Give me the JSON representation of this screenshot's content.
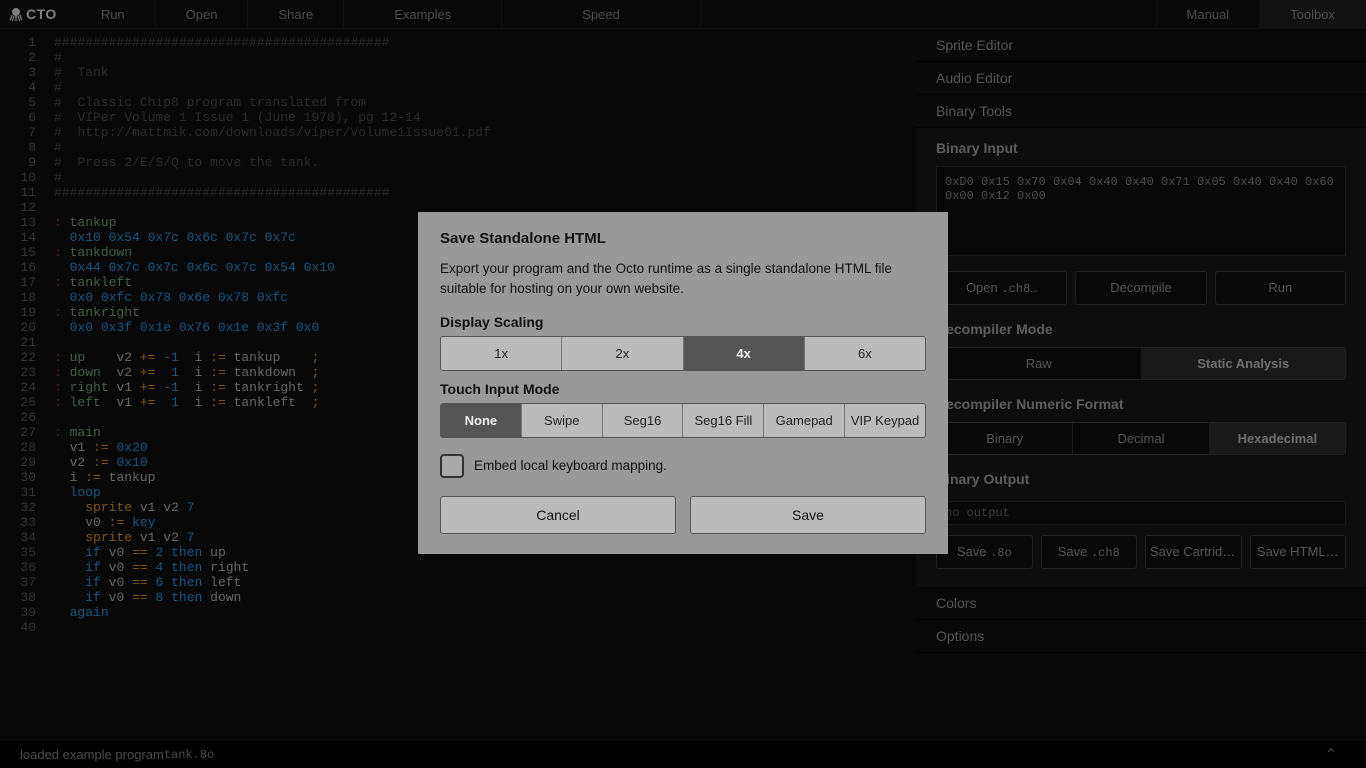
{
  "logo_text": "CTO",
  "topbar": {
    "run": "Run",
    "open": "Open",
    "share": "Share",
    "examples": "Examples",
    "speed": "Speed",
    "manual": "Manual",
    "toolbox": "Toolbox"
  },
  "code_lines": [
    {
      "n": 1,
      "html": "<span class='c-comment'>###########################################</span>"
    },
    {
      "n": 2,
      "html": "<span class='c-comment'>#</span>"
    },
    {
      "n": 3,
      "html": "<span class='c-comment'>#  Tank</span>"
    },
    {
      "n": 4,
      "html": "<span class='c-comment'>#</span>"
    },
    {
      "n": 5,
      "html": "<span class='c-comment'>#  Classic Chip8 program translated from</span>"
    },
    {
      "n": 6,
      "html": "<span class='c-comment'>#  VIPer Volume 1 Issue 1 (June 1978), pg 12-14</span>"
    },
    {
      "n": 7,
      "html": "<span class='c-comment'>#  http://mattmik.com/downloads/viper/Volume1Issue01.pdf</span>"
    },
    {
      "n": 8,
      "html": "<span class='c-comment'>#</span>"
    },
    {
      "n": 9,
      "html": "<span class='c-comment'>#  Press 2/E/S/Q to move the tank.</span>"
    },
    {
      "n": 10,
      "html": "<span class='c-comment'>#</span>"
    },
    {
      "n": 11,
      "html": "<span class='c-comment'>###########################################</span>"
    },
    {
      "n": 12,
      "html": ""
    },
    {
      "n": 13,
      "html": "<span class='c-label'>:</span> <span class='c-def'>tankup</span>"
    },
    {
      "n": 14,
      "html": "  <span class='c-num'>0x10 0x54 0x7c 0x6c 0x7c 0x7c</span>"
    },
    {
      "n": 15,
      "html": "<span class='c-label'>:</span> <span class='c-def'>tankdown</span>"
    },
    {
      "n": 16,
      "html": "  <span class='c-num'>0x44 0x7c 0x7c 0x6c 0x7c 0x54 0x10</span>"
    },
    {
      "n": 17,
      "html": "<span class='c-label'>:</span> <span class='c-def'>tankleft</span>"
    },
    {
      "n": 18,
      "html": "  <span class='c-num'>0x0 0xfc 0x78 0x6e 0x78 0xfc</span>"
    },
    {
      "n": 19,
      "html": "<span class='c-label'>:</span> <span class='c-def'>tankright</span>"
    },
    {
      "n": 20,
      "html": "  <span class='c-num'>0x0 0x3f 0x1e 0x76 0x1e 0x3f 0x0</span>"
    },
    {
      "n": 21,
      "html": ""
    },
    {
      "n": 22,
      "html": "<span class='c-label'>:</span> <span class='c-def'>up</span>    <span class='c-id'>v2</span> <span class='c-op'>+=</span> <span class='c-num'>-1</span>  <span class='c-id'>i</span> <span class='c-op'>:=</span> <span class='c-id'>tankup</span>    <span class='c-at'>;</span>"
    },
    {
      "n": 23,
      "html": "<span class='c-label'>:</span> <span class='c-def'>down</span>  <span class='c-id'>v2</span> <span class='c-op'>+=</span>  <span class='c-num'>1</span>  <span class='c-id'>i</span> <span class='c-op'>:=</span> <span class='c-id'>tankdown</span>  <span class='c-at'>;</span>"
    },
    {
      "n": 24,
      "html": "<span class='c-label'>:</span> <span class='c-def'>right</span> <span class='c-id'>v1</span> <span class='c-op'>+=</span> <span class='c-num'>-1</span>  <span class='c-id'>i</span> <span class='c-op'>:=</span> <span class='c-id'>tankright</span> <span class='c-at'>;</span>"
    },
    {
      "n": 25,
      "html": "<span class='c-label'>:</span> <span class='c-def'>left</span>  <span class='c-id'>v1</span> <span class='c-op'>+=</span>  <span class='c-num'>1</span>  <span class='c-id'>i</span> <span class='c-op'>:=</span> <span class='c-id'>tankleft</span>  <span class='c-at'>;</span>"
    },
    {
      "n": 26,
      "html": ""
    },
    {
      "n": 27,
      "html": "<span class='c-label'>:</span> <span class='c-def'>main</span>"
    },
    {
      "n": 28,
      "html": "  <span class='c-id'>v1</span> <span class='c-op'>:=</span> <span class='c-num'>0x20</span>"
    },
    {
      "n": 29,
      "html": "  <span class='c-id'>v2</span> <span class='c-op'>:=</span> <span class='c-num'>0x10</span>"
    },
    {
      "n": 30,
      "html": "  <span class='c-id'>i</span> <span class='c-op'>:=</span> <span class='c-id'>tankup</span>"
    },
    {
      "n": 31,
      "html": "  <span class='c-kw'>loop</span>"
    },
    {
      "n": 32,
      "html": "    <span class='c-op'>sprite</span> <span class='c-id'>v1</span> <span class='c-id'>v2</span> <span class='c-num'>7</span>"
    },
    {
      "n": 33,
      "html": "    <span class='c-id'>v0</span> <span class='c-op'>:=</span> <span class='c-kw'>key</span>"
    },
    {
      "n": 34,
      "html": "    <span class='c-op'>sprite</span> <span class='c-id'>v1</span> <span class='c-id'>v2</span> <span class='c-num'>7</span>"
    },
    {
      "n": 35,
      "html": "    <span class='c-kw'>if</span> <span class='c-id'>v0</span> <span class='c-op'>==</span> <span class='c-num'>2</span> <span class='c-kw'>then</span> <span class='c-id'>up</span>"
    },
    {
      "n": 36,
      "html": "    <span class='c-kw'>if</span> <span class='c-id'>v0</span> <span class='c-op'>==</span> <span class='c-num'>4</span> <span class='c-kw'>then</span> <span class='c-id'>right</span>"
    },
    {
      "n": 37,
      "html": "    <span class='c-kw'>if</span> <span class='c-id'>v0</span> <span class='c-op'>==</span> <span class='c-num'>6</span> <span class='c-kw'>then</span> <span class='c-id'>left</span>"
    },
    {
      "n": 38,
      "html": "    <span class='c-kw'>if</span> <span class='c-id'>v0</span> <span class='c-op'>==</span> <span class='c-num'>8</span> <span class='c-kw'>then</span> <span class='c-id'>down</span>"
    },
    {
      "n": 39,
      "html": "  <span class='c-kw'>again</span>"
    },
    {
      "n": 40,
      "html": ""
    }
  ],
  "sidebar": {
    "sections": {
      "sprite": "Sprite Editor",
      "audio": "Audio Editor",
      "binary": "Binary Tools",
      "colors": "Colors",
      "options": "Options"
    },
    "binary": {
      "input_heading": "Binary Input",
      "input_value": "0xD0 0x15 0x70 0x04 0x40 0x40 0x71 0x05 0x40 0x40 0x60 0x00 0x12 0x00",
      "open_label": "Open ",
      "open_ext": ".ch8…",
      "decompile": "Decompile",
      "run": "Run",
      "mode_heading": "Decompiler Mode",
      "mode_options": [
        "Raw",
        "Static Analysis"
      ],
      "mode_selected": 1,
      "fmt_heading": "Decompiler Numeric Format",
      "fmt_options": [
        "Binary",
        "Decimal",
        "Hexadecimal"
      ],
      "fmt_selected": 2,
      "output_heading": "Binary Output",
      "output_placeholder": "no output",
      "save8o": "Save ",
      "save8o_ext": ".8o",
      "savech8": "Save ",
      "savech8_ext": ".ch8",
      "savecart": "Save Cartridge…",
      "savehtml": "Save HTML…"
    }
  },
  "status": {
    "text": "loaded example program ",
    "file": "tank.8o",
    "caret": "^"
  },
  "modal": {
    "title": "Save Standalone HTML",
    "desc": "Export your program and the Octo runtime as a single standalone HTML file suitable for hosting on your own website.",
    "scale_label": "Display Scaling",
    "scale_options": [
      "1x",
      "2x",
      "4x",
      "6x"
    ],
    "scale_selected": 2,
    "touch_label": "Touch Input Mode",
    "touch_options": [
      "None",
      "Swipe",
      "Seg16",
      "Seg16 Fill",
      "Gamepad",
      "VIP Keypad"
    ],
    "touch_selected": 0,
    "embed_label": "Embed local keyboard mapping.",
    "cancel": "Cancel",
    "save": "Save"
  }
}
